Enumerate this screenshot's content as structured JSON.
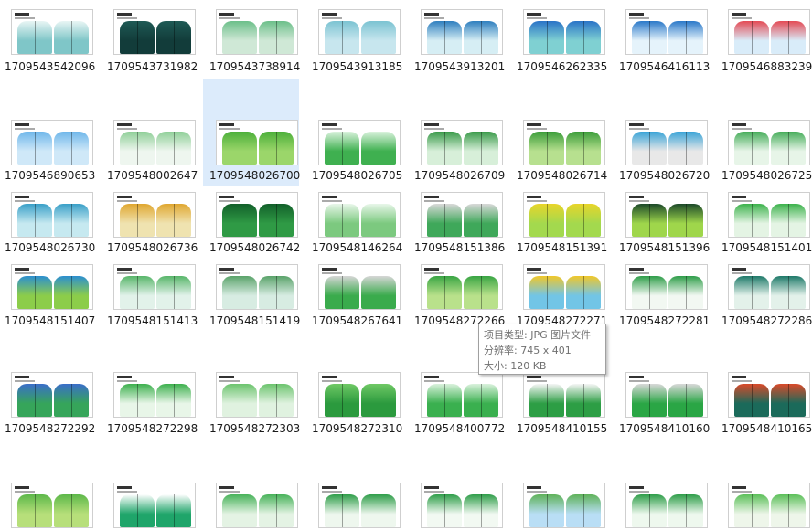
{
  "selected_index": 10,
  "tooltip": {
    "type_line": "项目类型: JPG 图片文件",
    "resolution_line": "分辨率: 745 x 401",
    "size_line": "大小: 120 KB"
  },
  "files": [
    {
      "name": "1709543542096",
      "color": "#7fc6c8",
      "accent": "#e8f5f4"
    },
    {
      "name": "1709543731982",
      "color": "#123c3a",
      "accent": "#1f5a55"
    },
    {
      "name": "1709543738914",
      "color": "#cfe8d6",
      "accent": "#6cbf8a"
    },
    {
      "name": "1709543913185",
      "color": "#c7e6ee",
      "accent": "#7cc3d2"
    },
    {
      "name": "1709543913201",
      "color": "#d6eef4",
      "accent": "#2f7fbf"
    },
    {
      "name": "1709546262335",
      "color": "#7fd0d2",
      "accent": "#2a74c7"
    },
    {
      "name": "1709546416113",
      "color": "#e5f3fb",
      "accent": "#2b79c9"
    },
    {
      "name": "1709546883239",
      "color": "#d9ecf9",
      "accent": "#e44b55"
    },
    {
      "name": "1709546890653",
      "color": "#cfe8f8",
      "accent": "#6fb7ea"
    },
    {
      "name": "1709548002647",
      "color": "#eef6ef",
      "accent": "#8fcf98"
    },
    {
      "name": "1709548026700",
      "color": "#9bd66a",
      "accent": "#4caf3a"
    },
    {
      "name": "1709548026705",
      "color": "#3fb050",
      "accent": "#d9f2dc"
    },
    {
      "name": "1709548026709",
      "color": "#d7efd9",
      "accent": "#3a9a4a"
    },
    {
      "name": "1709548026714",
      "color": "#b7e08f",
      "accent": "#3b9d3a"
    },
    {
      "name": "1709548026720",
      "color": "#e8e8e8",
      "accent": "#3aa4d7"
    },
    {
      "name": "1709548026725",
      "color": "#e7f5e8",
      "accent": "#46ad5a"
    },
    {
      "name": "1709548026730",
      "color": "#c6e9f0",
      "accent": "#3aa0c8"
    },
    {
      "name": "1709548026736",
      "color": "#efe3b0",
      "accent": "#e0a730"
    },
    {
      "name": "1709548026742",
      "color": "#2f9a45",
      "accent": "#12602a"
    },
    {
      "name": "1709548146264",
      "color": "#7cc97f",
      "accent": "#e8f6e9"
    },
    {
      "name": "1709548151386",
      "color": "#3fa85a",
      "accent": "#d8d8d8"
    },
    {
      "name": "1709548151391",
      "color": "#a3d94e",
      "accent": "#e8d52a"
    },
    {
      "name": "1709548151396",
      "color": "#9fd64b",
      "accent": "#1d4a2a"
    },
    {
      "name": "1709548151401",
      "color": "#e4f4e4",
      "accent": "#3db34d"
    },
    {
      "name": "1709548151407",
      "color": "#8ccd4a",
      "accent": "#2c8fcf"
    },
    {
      "name": "1709548151413",
      "color": "#e2f2ea",
      "accent": "#58b66a"
    },
    {
      "name": "1709548151419",
      "color": "#d7ece2",
      "accent": "#5aa36a"
    },
    {
      "name": "1709548267641",
      "color": "#3aab4c",
      "accent": "#d6d6d6"
    },
    {
      "name": "1709548272266",
      "color": "#b9e18b",
      "accent": "#39a544"
    },
    {
      "name": "1709548272271",
      "color": "#72c5e6",
      "accent": "#f0c72a"
    },
    {
      "name": "1709548272281",
      "color": "#f2f8f2",
      "accent": "#2f9e4a"
    },
    {
      "name": "1709548272286",
      "color": "#e3f1ea",
      "accent": "#1f7a6a"
    },
    {
      "name": "1709548272292",
      "color": "#36a55a",
      "accent": "#3a6ec9"
    },
    {
      "name": "1709548272298",
      "color": "#e8f6e8",
      "accent": "#3db04e"
    },
    {
      "name": "1709548272303",
      "color": "#e0f2e0",
      "accent": "#6cc46e"
    },
    {
      "name": "1709548272310",
      "color": "#2b9a3e",
      "accent": "#6fc865"
    },
    {
      "name": "1709548400772",
      "color": "#3ab04f",
      "accent": "#d9f1dc"
    },
    {
      "name": "1709548410155",
      "color": "#2d9e45",
      "accent": "#f5f5f5"
    },
    {
      "name": "1709548410160",
      "color": "#2aa645",
      "accent": "#d8d8d8"
    },
    {
      "name": "1709548410165",
      "color": "#1b6a5a",
      "accent": "#d94a2a"
    },
    {
      "name": "",
      "color": "#b7df7a",
      "accent": "#5db84a"
    },
    {
      "name": "",
      "color": "#1fa56a",
      "accent": "#ffffff"
    },
    {
      "name": "",
      "color": "#e4f3e4",
      "accent": "#48b35a"
    },
    {
      "name": "",
      "color": "#eef7ee",
      "accent": "#2f9e4a"
    },
    {
      "name": "",
      "color": "#f2f9f2",
      "accent": "#2f9e4a"
    },
    {
      "name": "",
      "color": "#b9def5",
      "accent": "#5fb25a"
    },
    {
      "name": "",
      "color": "#eef8ee",
      "accent": "#2f9e4a"
    },
    {
      "name": "",
      "color": "#eef6ea",
      "accent": "#5cc05a"
    }
  ]
}
